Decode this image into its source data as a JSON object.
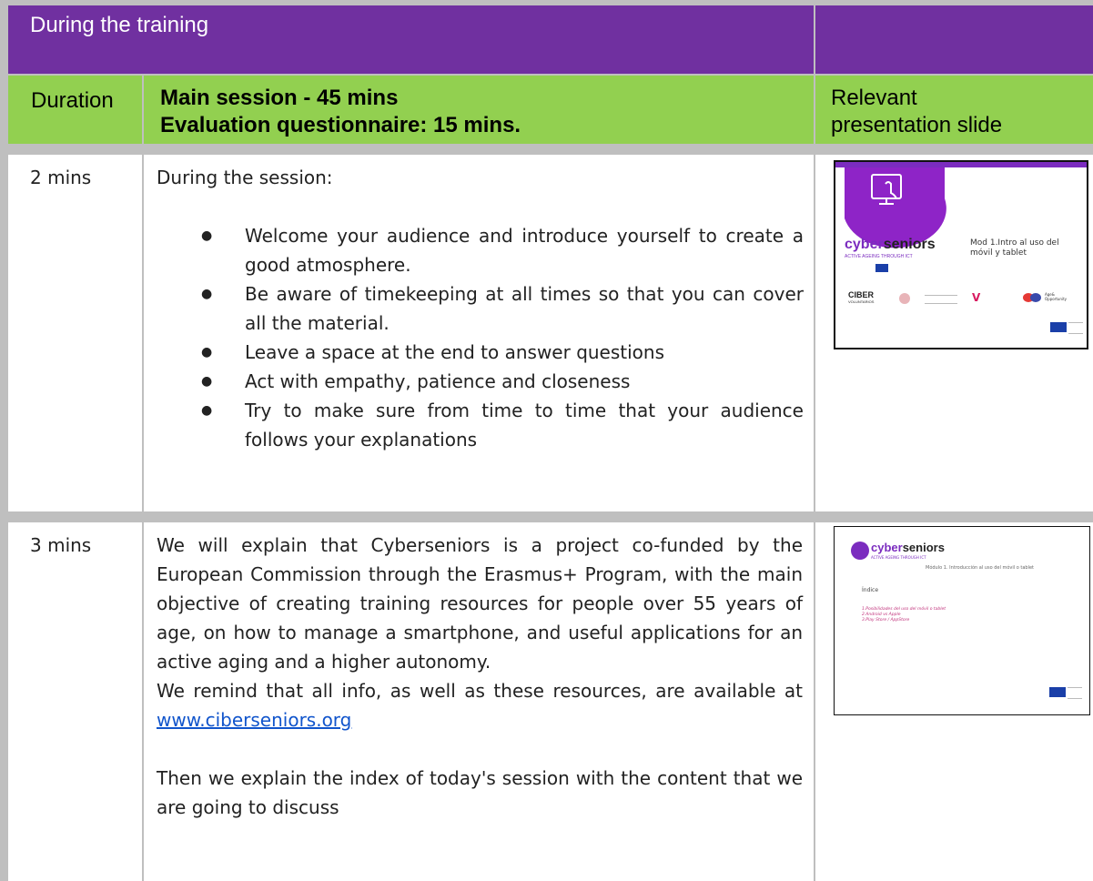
{
  "table": {
    "title": "During the training",
    "header": {
      "duration": "Duration",
      "main_line1": "Main session - 45 mins",
      "main_line2": "Evaluation questionnaire: 15 mins.",
      "relevant_line1": "Relevant",
      "relevant_line2": "presentation slide"
    },
    "rows": [
      {
        "time": "2 mins",
        "intro": "During the session:",
        "bullets": [
          "Welcome your audience and introduce yourself to create a good atmosphere.",
          "Be aware of timekeeping at all times so that you can cover all the material.",
          "Leave a space at the end to answer questions",
          "Act with empathy, patience and closeness",
          "Try to make sure from time to time that your audience follows your explanations"
        ]
      },
      {
        "time": "3 mins",
        "para1": "We will explain that Cyberseniors is a project co-funded by the European Commission through the Erasmus+ Program, with the main objective of creating training resources for people over 55 years of age, on how to manage a smartphone, and useful applications for an active aging and a higher autonomy.",
        "para2_pre": "We remind that all info, as well as these resources, are available at ",
        "para2_link": "www.ciberseniors.org",
        "para3": "Then we explain the  index of today's session with the content that we are going to discuss"
      }
    ]
  },
  "slide1": {
    "logo_a": "cyber",
    "logo_b": "seniors",
    "tagline": "ACTIVE AGEING THROUGH ICT",
    "title_line1": "Mod 1.Intro al uso del",
    "title_line2": "móvil y tablet",
    "partner1": "CIBER",
    "partner1_sub": "VOLUNTARIOS",
    "partner2": "Age&",
    "partner2_sub": "Opportunity"
  },
  "slide2": {
    "logo_a": "cyber",
    "logo_b": "seniors",
    "tagline": "ACTIVE AGEING THROUGH ICT",
    "subtitle": "Módulo 1. Introducción al uso del móvil o tablet",
    "index_title": "Índice",
    "items": [
      "1.Posibilidades del uso del móvil o tablet",
      "2.Android vs Apple",
      "3.Play Store / AppStore"
    ]
  },
  "colors": {
    "header_purple": "#7030a0",
    "header_green": "#92d050",
    "link_blue": "#1155cc"
  }
}
